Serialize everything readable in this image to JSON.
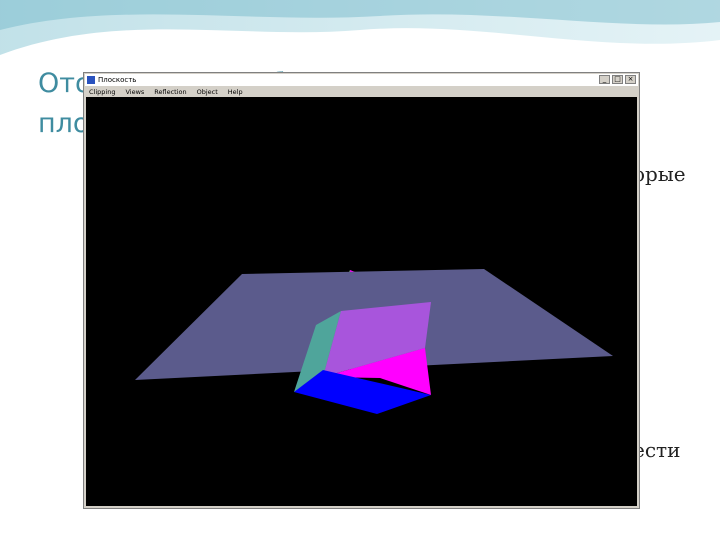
{
  "slide": {
    "title_line1": "Ото",
    "title_line1_end": "б",
    "title_line2": "пло",
    "bg_text_1": "орые",
    "bg_text_2": "ести"
  },
  "window": {
    "title": "Плоскость",
    "menu": [
      "Clipping",
      "Views",
      "Reflection",
      "Object",
      "Help"
    ],
    "buttons": [
      "_",
      "□",
      "×"
    ]
  },
  "colors": {
    "title": "#3f8ca0",
    "plane": "#5b5b8c",
    "magenta": "#ff00ff",
    "green": "#00ff00",
    "blue": "#0000ff",
    "violet": "#a855dc",
    "teal": "#4fa59b"
  }
}
